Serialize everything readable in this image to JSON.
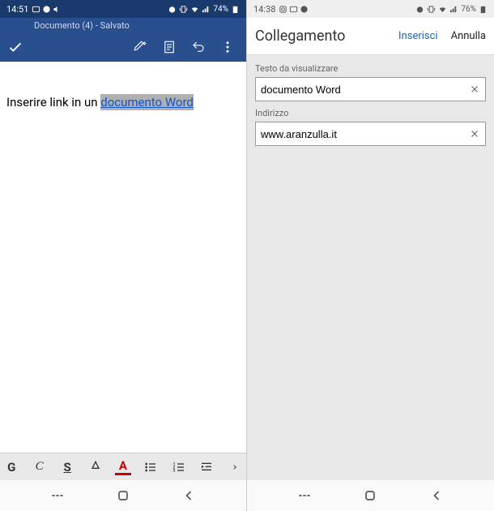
{
  "left": {
    "statusbar": {
      "time": "14:51",
      "battery": "74%"
    },
    "header": {
      "doc_title": "Documento (4) - Salvato"
    },
    "document": {
      "text_before": "Inserire link in un ",
      "selected_text": "documento Word"
    },
    "format": {
      "bold": "G",
      "italic": "C",
      "underline": "S",
      "font_color": "A"
    }
  },
  "right": {
    "statusbar": {
      "time": "14:38",
      "battery": "76%"
    },
    "dialog": {
      "title": "Collegamento",
      "insert": "Inserisci",
      "cancel": "Annulla",
      "display_label": "Testo da visualizzare",
      "display_value": "documento Word",
      "address_label": "Indirizzo",
      "address_value": "www.aranzulla.it"
    }
  }
}
